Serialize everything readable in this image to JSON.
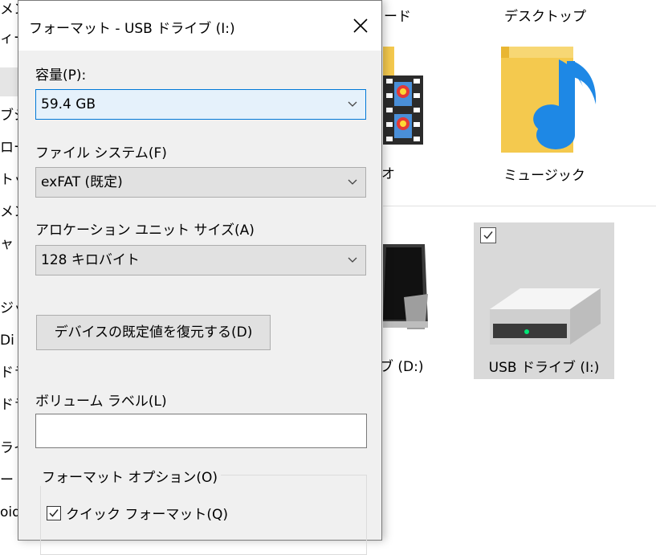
{
  "nav": {
    "items": [
      "メン",
      "ィー",
      "",
      "ブジ",
      "ロー",
      "トッ",
      "メン",
      "ャ",
      "ジッ",
      "Di",
      "ドラ",
      "ドラ",
      "ライ",
      "ート",
      "oid"
    ]
  },
  "explorer": {
    "downloads_fragment": "ード",
    "desktop_label": "デスクトップ",
    "videos_fragment": "オ",
    "music_label": "ミュージック",
    "drive_d_label": "ブ (D:)",
    "usb_label": "USB ドライブ (I:)"
  },
  "dialog": {
    "title": "フォーマット - USB ドライブ (I:)",
    "capacity_label": "容量(P):",
    "capacity_value": "59.4 GB",
    "filesystem_label": "ファイル システム(F)",
    "filesystem_value": "exFAT (既定)",
    "allocation_label": "アロケーション ユニット サイズ(A)",
    "allocation_value": "128 キロバイト",
    "restore_button": "デバイスの既定値を復元する(D)",
    "volume_label": "ボリューム ラベル(L)",
    "volume_value": "",
    "options_legend": "フォーマット オプション(O)",
    "quick_format_label": "クイック フォーマット(Q)",
    "quick_format_checked": true
  },
  "colors": {
    "dialog_bg": "#f0f0f0",
    "focus_border": "#0078d7",
    "folder_yellow": "#f4c94e",
    "music_blue": "#1e88e5",
    "selection_bg": "#d9d9d9"
  }
}
